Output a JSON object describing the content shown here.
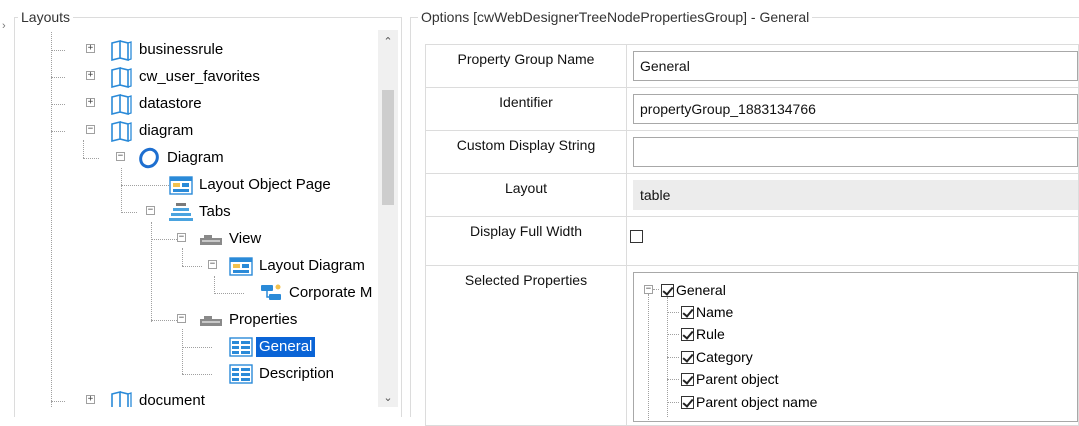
{
  "layouts_panel": {
    "title": "Layouts",
    "tree": [
      {
        "id": "businessrule",
        "label": "businessrule",
        "icon": "book-icon",
        "expander": "+"
      },
      {
        "id": "cw_user_favorites",
        "label": "cw_user_favorites",
        "icon": "book-icon",
        "expander": "+"
      },
      {
        "id": "datastore",
        "label": "datastore",
        "icon": "book-icon",
        "expander": "+"
      },
      {
        "id": "diagram",
        "label": "diagram",
        "icon": "book-icon",
        "expander": "-"
      },
      {
        "id": "diagram_node",
        "label": "Diagram",
        "icon": "circle-node-icon",
        "expander": "-"
      },
      {
        "id": "layout_object_page",
        "label": "Layout Object Page",
        "icon": "layout-page-icon",
        "expander": ""
      },
      {
        "id": "tabs",
        "label": "Tabs",
        "icon": "tabs-stack-icon",
        "expander": "-"
      },
      {
        "id": "view",
        "label": "View",
        "icon": "tab-folder-icon",
        "expander": "-"
      },
      {
        "id": "layout_diagram",
        "label": "Layout Diagram",
        "icon": "layout-page-icon",
        "expander": "-"
      },
      {
        "id": "corporate_m",
        "label": "Corporate M",
        "icon": "corporate-model-icon",
        "expander": ""
      },
      {
        "id": "properties",
        "label": "Properties",
        "icon": "tab-folder-icon",
        "expander": "-"
      },
      {
        "id": "general",
        "label": "General",
        "icon": "property-group-icon",
        "expander": "",
        "selected": true
      },
      {
        "id": "description",
        "label": "Description",
        "icon": "property-group-icon",
        "expander": ""
      },
      {
        "id": "document",
        "label": "document",
        "icon": "book-icon",
        "expander": "+"
      }
    ]
  },
  "options_panel": {
    "title": "Options [cwWebDesignerTreeNodePropertiesGroup] - General",
    "fields": {
      "property_group_name": {
        "label": "Property Group Name",
        "value": "General"
      },
      "identifier": {
        "label": "Identifier",
        "value": "propertyGroup_1883134766"
      },
      "custom_display_string": {
        "label": "Custom Display String",
        "value": ""
      },
      "layout": {
        "label": "Layout",
        "value": "table"
      },
      "display_full_width": {
        "label": "Display Full Width",
        "checked": false
      },
      "selected_properties": {
        "label": "Selected Properties"
      }
    },
    "selected_properties": {
      "group": {
        "label": "General",
        "checked": true
      },
      "items": [
        {
          "label": "Name",
          "checked": true
        },
        {
          "label": "Rule",
          "checked": true
        },
        {
          "label": "Category",
          "checked": true
        },
        {
          "label": "Parent object",
          "checked": true
        },
        {
          "label": "Parent object name",
          "checked": true
        }
      ]
    }
  },
  "colors": {
    "selection": "#0a64d6",
    "icon_blue": "#2a8ad8",
    "frame": "#dcdcdc"
  }
}
